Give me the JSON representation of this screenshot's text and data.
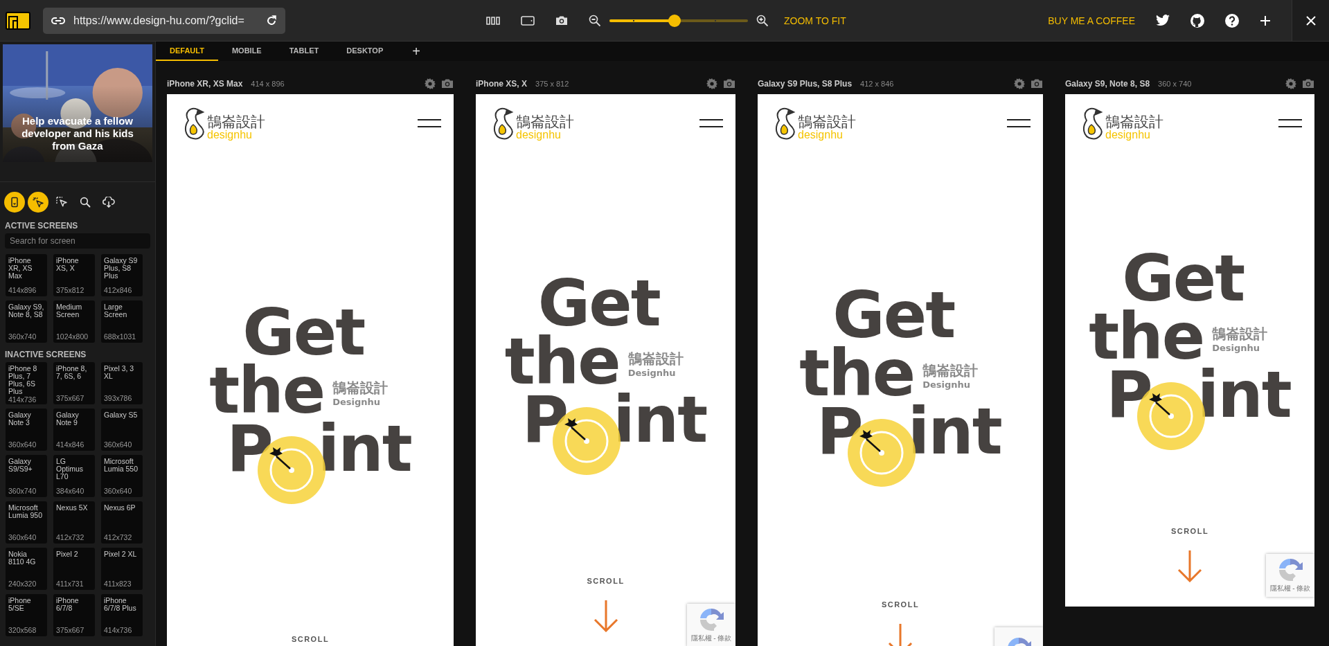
{
  "toolbar": {
    "url": "https://www.design-hu.com/?gclid=",
    "zoom": {
      "level": 0.47
    },
    "zoom_fit": "ZOOM TO FIT",
    "coffee": "BUY ME A COFFEE"
  },
  "sidebar": {
    "banner": {
      "kind": "picture",
      "text": "Help evacuate a fellow developer and his kids from Gaza"
    },
    "tools": [
      {
        "active": true
      },
      {
        "active": true
      },
      {
        "active": false
      },
      {
        "active": false
      },
      {
        "active": false
      }
    ],
    "active_title": "ACTIVE SCREENS",
    "search": {
      "placeholder": "Search for screen"
    },
    "active_screens": [
      {
        "name": "iPhone XR, XS Max",
        "size": "414x896"
      },
      {
        "name": "iPhone XS, X",
        "size": "375x812"
      },
      {
        "name": "Galaxy S9 Plus, S8 Plus",
        "size": "412x846"
      },
      {
        "name": "Galaxy S9, Note 8, S8",
        "size": "360x740"
      },
      {
        "name": "Medium Screen",
        "size": "1024x800"
      },
      {
        "name": "Large Screen",
        "size": "688x1031"
      }
    ],
    "inactive_title": "INACTIVE SCREENS",
    "inactive_screens": [
      {
        "name": "iPhone 8 Plus, 7 Plus, 6S Plus",
        "size": "414x736"
      },
      {
        "name": "iPhone 8, 7, 6S, 6",
        "size": "375x667"
      },
      {
        "name": "Pixel 3, 3 XL",
        "size": "393x786"
      },
      {
        "name": "Galaxy Note 3",
        "size": "360x640"
      },
      {
        "name": "Galaxy Note 9",
        "size": "414x846"
      },
      {
        "name": "Galaxy S5",
        "size": "360x640"
      },
      {
        "name": "Galaxy S9/S9+",
        "size": "360x740"
      },
      {
        "name": "LG Optimus L70",
        "size": "384x640"
      },
      {
        "name": "Microsoft Lumia 550",
        "size": "360x640"
      },
      {
        "name": "Microsoft Lumia 950",
        "size": "360x640"
      },
      {
        "name": "Nexus 5X",
        "size": "412x732"
      },
      {
        "name": "Nexus 6P",
        "size": "412x732"
      },
      {
        "name": "Nokia 8110 4G",
        "size": "240x320"
      },
      {
        "name": "Pixel 2",
        "size": "411x731"
      },
      {
        "name": "Pixel 2 XL",
        "size": "411x823"
      },
      {
        "name": "iPhone 5/SE",
        "size": "320x568"
      },
      {
        "name": "iPhone 6/7/8",
        "size": "375x667"
      },
      {
        "name": "iPhone 6/7/8 Plus",
        "size": "414x736"
      }
    ]
  },
  "tabs": [
    {
      "label": "DEFAULT",
      "selected": true
    },
    {
      "label": "MOBILE",
      "selected": false
    },
    {
      "label": "TABLET",
      "selected": false
    },
    {
      "label": "DESKTOP",
      "selected": false
    }
  ],
  "add_tab": "+",
  "devices": [
    {
      "name": "iPhone XR, XS Max",
      "size": "414 x 896",
      "site": {
        "logo_cn": "鵠崙設計",
        "logo_en": "designhu",
        "headline": [
          "Get",
          "the",
          "P",
          "int"
        ],
        "side_cn": "鵠崙設計",
        "side_en": "Designhu",
        "scroll": "SCROLL"
      }
    },
    {
      "name": "iPhone XS, X",
      "size": "375 x 812",
      "site": {
        "logo_cn": "鵠崙設計",
        "logo_en": "designhu",
        "headline": [
          "Get",
          "the",
          "P",
          "int"
        ],
        "side_cn": "鵠崙設計",
        "side_en": "Designhu",
        "scroll": "SCROLL",
        "scroll_arrow": true,
        "recaptcha_badge": true,
        "recaptcha": "隱私權 - 條款"
      }
    },
    {
      "name": "Galaxy S9 Plus, S8 Plus",
      "size": "412 x 846",
      "site": {
        "logo_cn": "鵠崙設計",
        "logo_en": "designhu",
        "headline": [
          "Get",
          "the",
          "P",
          "int"
        ],
        "side_cn": "鵠崙設計",
        "side_en": "Designhu",
        "scroll": "SCROLL",
        "scroll_arrow": true,
        "recaptcha_badge": true
      }
    },
    {
      "name": "Galaxy S9, Note 8, S8",
      "size": "360 x 740",
      "site": {
        "logo_cn": "鵠崙設計",
        "logo_en": "designhu",
        "headline": [
          "Get",
          "the",
          "P",
          "int"
        ],
        "side_cn": "鵠崙設計",
        "side_en": "Designhu",
        "scroll": "SCROLL",
        "scroll_arrow": true,
        "recaptcha_badge": true,
        "recaptcha": "隱私權 - 條款"
      }
    }
  ]
}
